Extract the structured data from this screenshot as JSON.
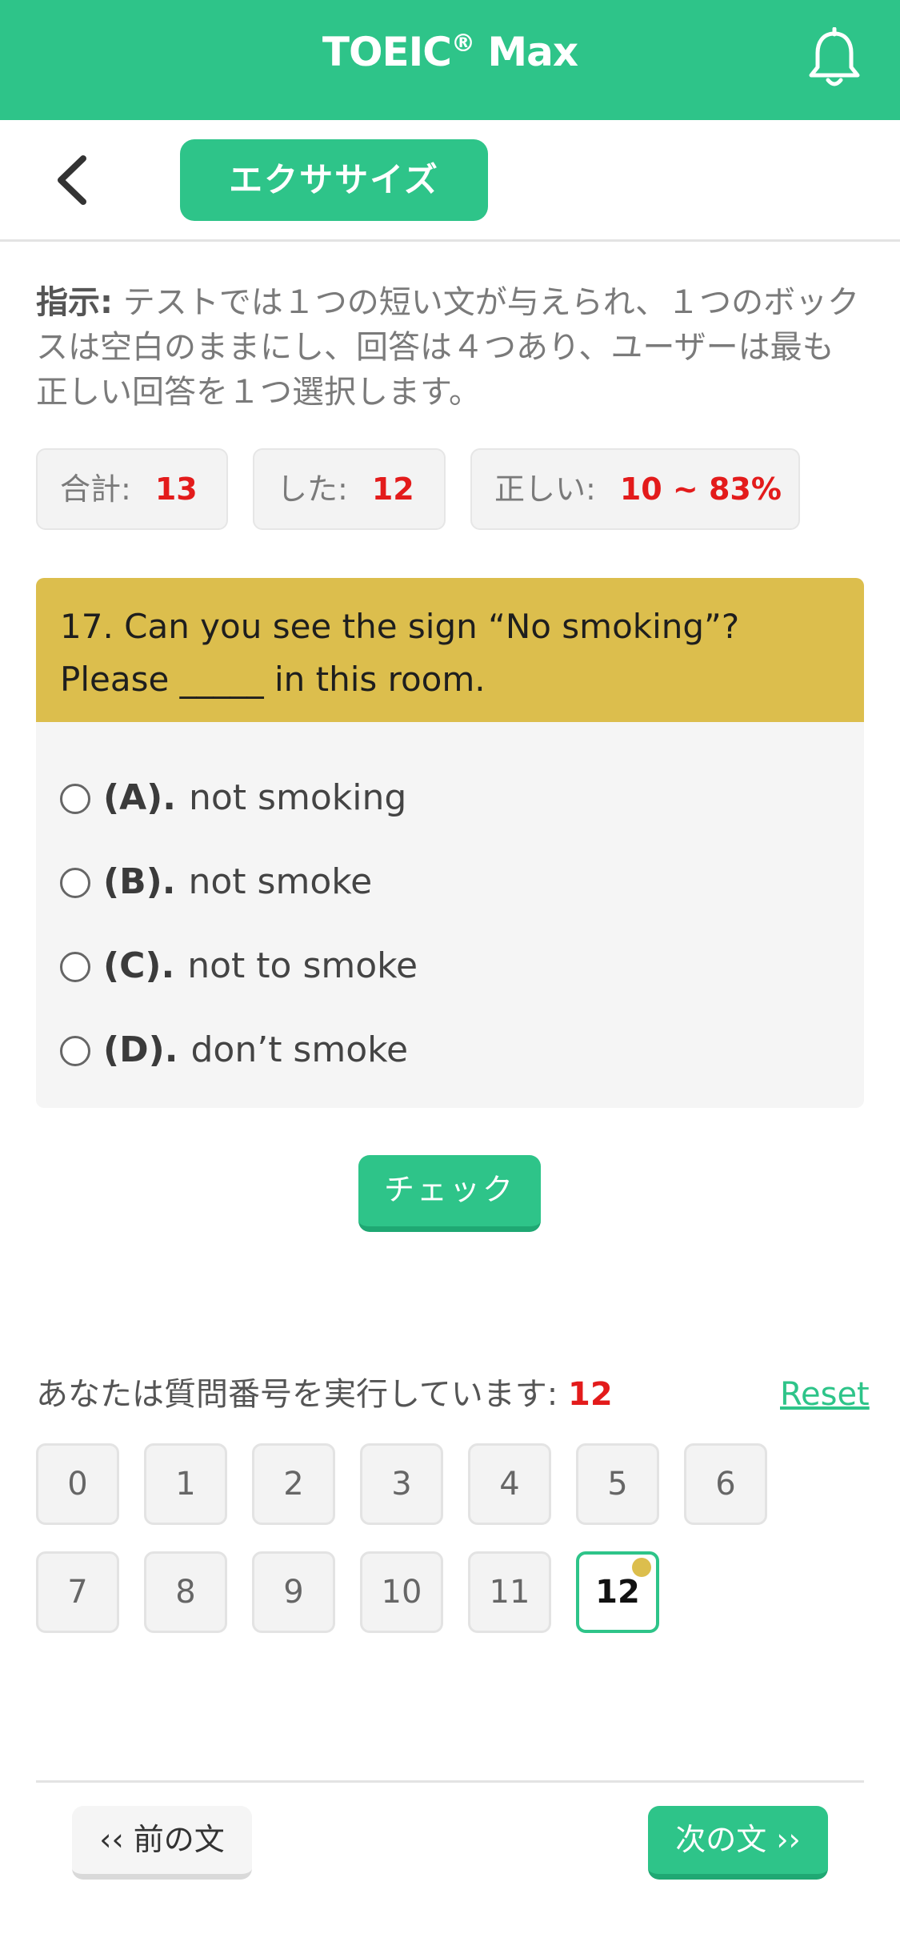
{
  "header": {
    "title": "TOEIC",
    "title_mark": "®",
    "title_suffix": " Max",
    "bell_icon": "bell-icon"
  },
  "subheader": {
    "back_icon": "chevron-left-icon",
    "mode_label": "エクササイズ"
  },
  "instructions": {
    "label": "指示:",
    "text": " テストでは１つの短い文が与えられ、１つのボックスは空白のままにし、回答は４つあり、ユーザーは最も正しい回答を１つ選択します。"
  },
  "stats": {
    "total_label": "合計:",
    "total_value": "13",
    "done_label": "した:",
    "done_value": "12",
    "correct_label": "正しい:",
    "correct_value": "10 ~ 83%"
  },
  "question": {
    "text": "17. Can you see the sign “No smoking”? Please _____ in this room.",
    "options": [
      {
        "key": "(A).",
        "text": "not smoking"
      },
      {
        "key": "(B).",
        "text": "not smoke"
      },
      {
        "key": "(C).",
        "text": "not to smoke"
      },
      {
        "key": "(D).",
        "text": "don’t smoke"
      }
    ]
  },
  "check_label": "チェック",
  "progress": {
    "running_label": "あなたは質問番号を実行しています: ",
    "current": "12",
    "reset_label": "Reset",
    "numbers": [
      "0",
      "1",
      "2",
      "3",
      "4",
      "5",
      "6",
      "7",
      "8",
      "9",
      "10",
      "11",
      "12"
    ]
  },
  "nav": {
    "prev_label": "‹‹ 前の文",
    "next_label": "次の文 ››"
  },
  "colors": {
    "primary": "#2ec489",
    "question_header": "#dcbe4d",
    "value_red": "#e31b1b"
  }
}
